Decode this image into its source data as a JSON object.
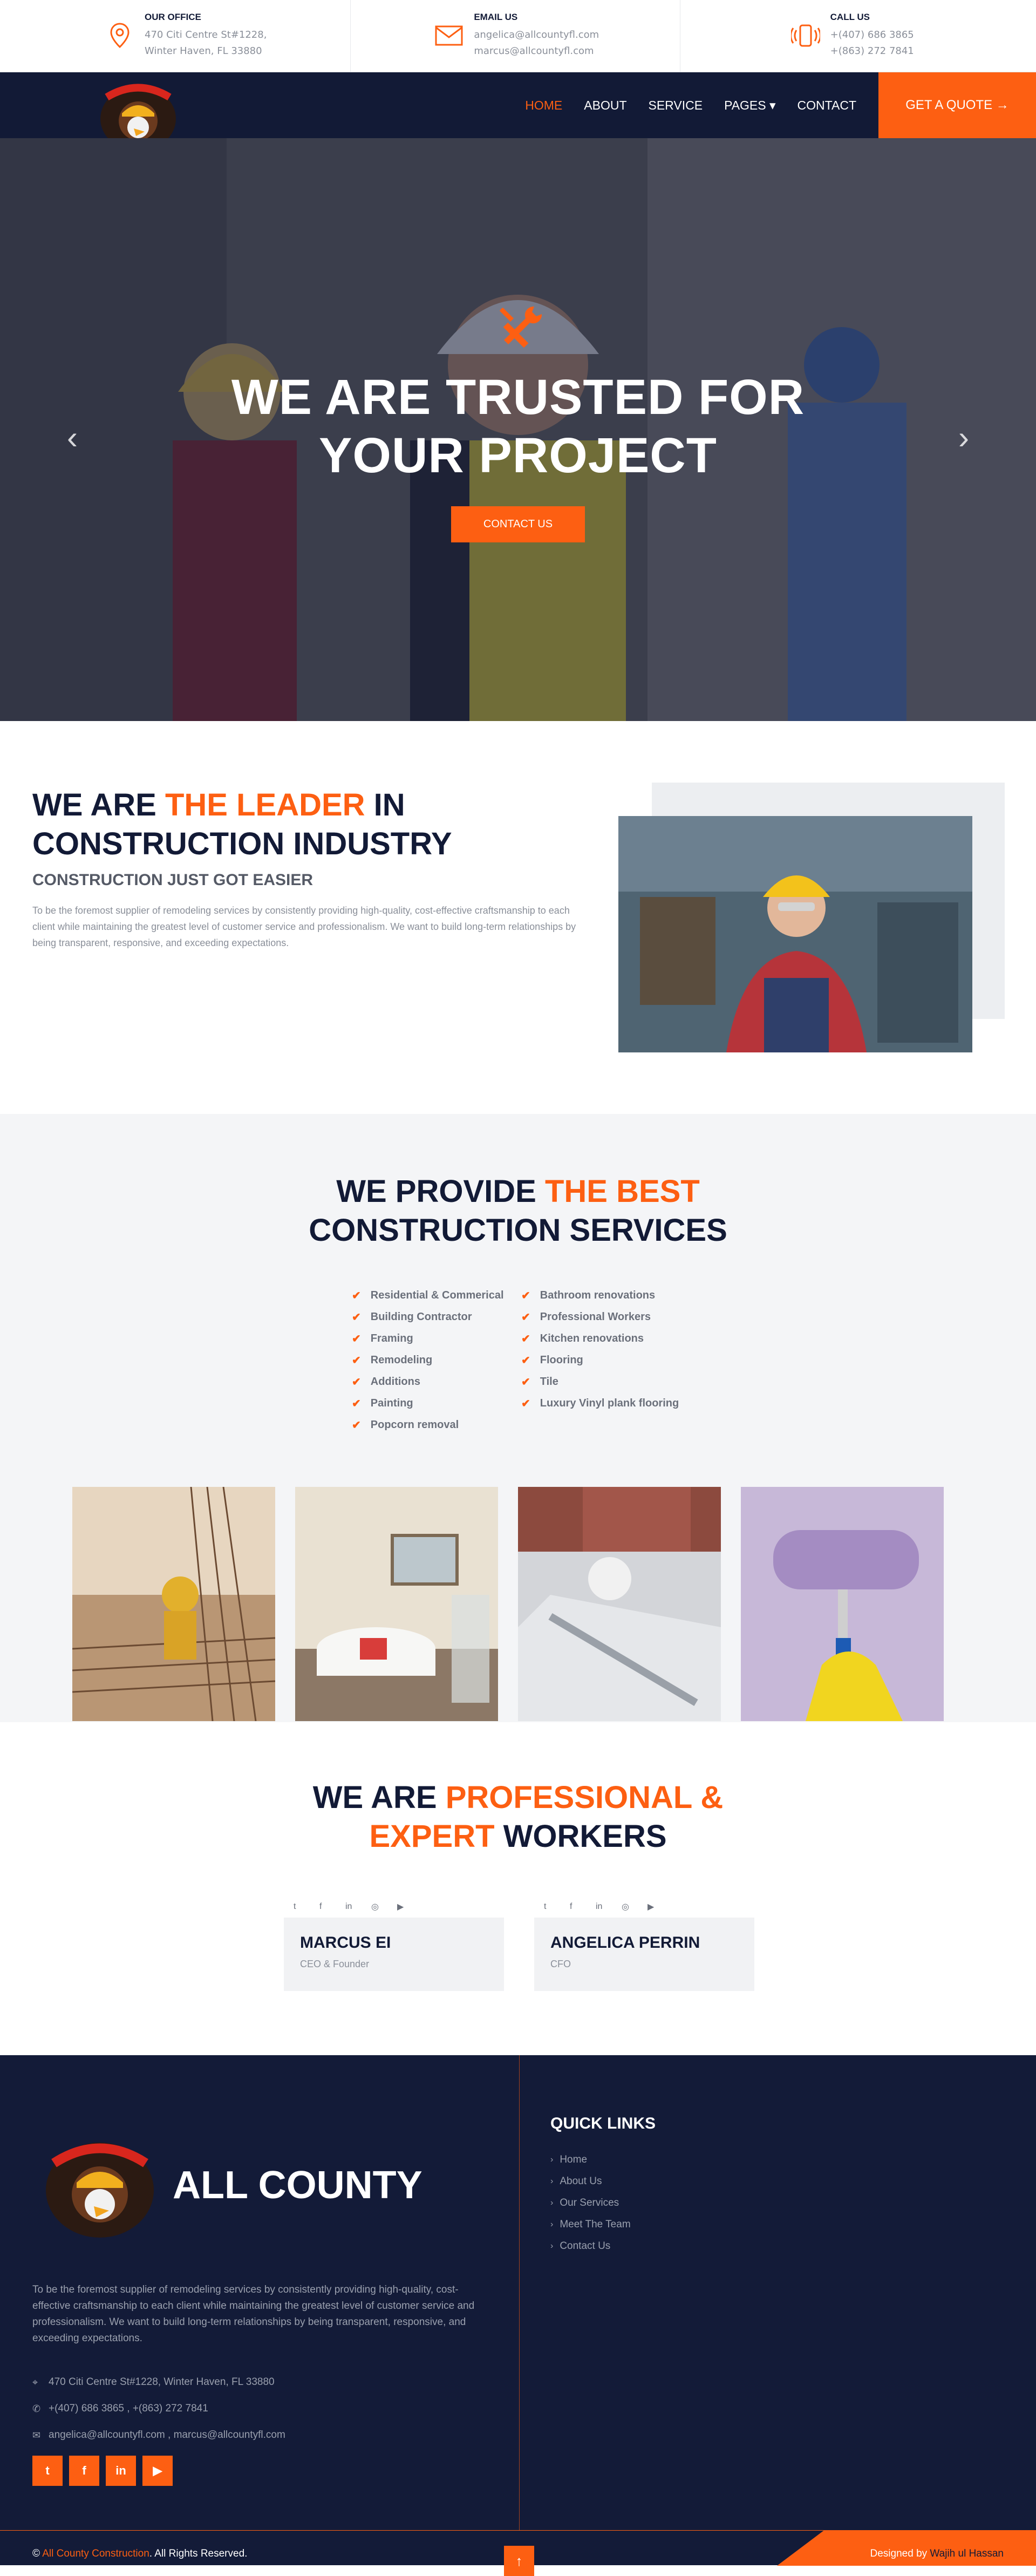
{
  "topbar": {
    "office": {
      "title": "OUR OFFICE",
      "line1": "470 Citi Centre St#1228,",
      "line2": "Winter Haven, FL 33880",
      "icon": "map-pin-icon"
    },
    "email": {
      "title": "EMAIL US",
      "line1": "angelica@allcountyfl.com",
      "line2": "marcus@allcountyfl.com",
      "icon": "envelope-icon"
    },
    "call": {
      "title": "CALL US",
      "line1": "+(407) 686 3865",
      "line2": "+(863) 272 7841",
      "icon": "phone-ring-icon"
    }
  },
  "nav": {
    "items": [
      "HOME",
      "ABOUT",
      "SERVICE",
      "PAGES ▾",
      "CONTACT"
    ],
    "active_index": 0,
    "quote": "GET A QUOTE →",
    "logo_text": "ALL COUNTY CONSTRUCTION"
  },
  "hero": {
    "title_line1": "WE ARE TRUSTED FOR",
    "title_line2": "YOUR PROJECT",
    "button": "CONTACT US",
    "prev": "‹",
    "next": "›"
  },
  "about": {
    "title_a": "WE ARE ",
    "title_hl": "THE LEADER",
    "title_b": " IN",
    "title_line2": "CONSTRUCTION INDUSTRY",
    "subtitle": "CONSTRUCTION JUST GOT EASIER",
    "text": "To be the foremost supplier of remodeling services by consistently providing high-quality, cost-effective craftsmanship to each client while maintaining the greatest level of customer service and professionalism. We want to build long-term relationships by being transparent, responsive, and exceeding expectations."
  },
  "services": {
    "title_a": "WE PROVIDE ",
    "title_hl": "THE BEST",
    "title_line2": "CONSTRUCTION SERVICES",
    "left": [
      "Residential & Commerical",
      "Building Contractor",
      "Framing",
      "Remodeling",
      "Additions",
      "Painting",
      "Popcorn removal"
    ],
    "right": [
      "Bathroom renovations",
      "Professional Workers",
      "Kitchen renovations",
      "Flooring",
      "Tile",
      "Luxury Vinyl plank flooring"
    ]
  },
  "team": {
    "title_a": "WE ARE ",
    "title_hl1": "PROFESSIONAL &",
    "title_hl2": "EXPERT",
    "title_b": " WORKERS",
    "members": [
      {
        "name": "MARCUS EI",
        "role": "CEO & Founder"
      },
      {
        "name": "ANGELICA PERRIN",
        "role": "CFO"
      }
    ],
    "social": [
      "t",
      "f",
      "in",
      "◎",
      "▶"
    ]
  },
  "footer": {
    "brand": "ALL COUNTY",
    "desc": "To be the foremost supplier of remodeling services by consistently providing high-quality, cost-effective craftsmanship to each client while maintaining the greatest level of customer service and professionalism. We want to build long-term relationships by being transparent, responsive, and exceeding expectations.",
    "address": "470 Citi Centre St#1228, Winter Haven, FL 33880",
    "phones": "+(407) 686 3865 , +(863) 272 7841",
    "emails": "angelica@allcountyfl.com , marcus@allcountyfl.com",
    "social": [
      "t",
      "f",
      "in",
      "▶"
    ],
    "quick_links_title": "QUICK LINKS",
    "links": [
      "Home",
      "About Us",
      "Our Services",
      "Meet The Team",
      "Contact Us"
    ],
    "copy_prefix": "© ",
    "copy_org": "All County Construction",
    "copy_suffix": ". All Rights Reserved.",
    "designed_label": "Designed by ",
    "designed_name": "Wajih ul Hassan",
    "to_top": "↑"
  },
  "colors": {
    "accent": "#fd5f12",
    "navy": "#121a36"
  }
}
